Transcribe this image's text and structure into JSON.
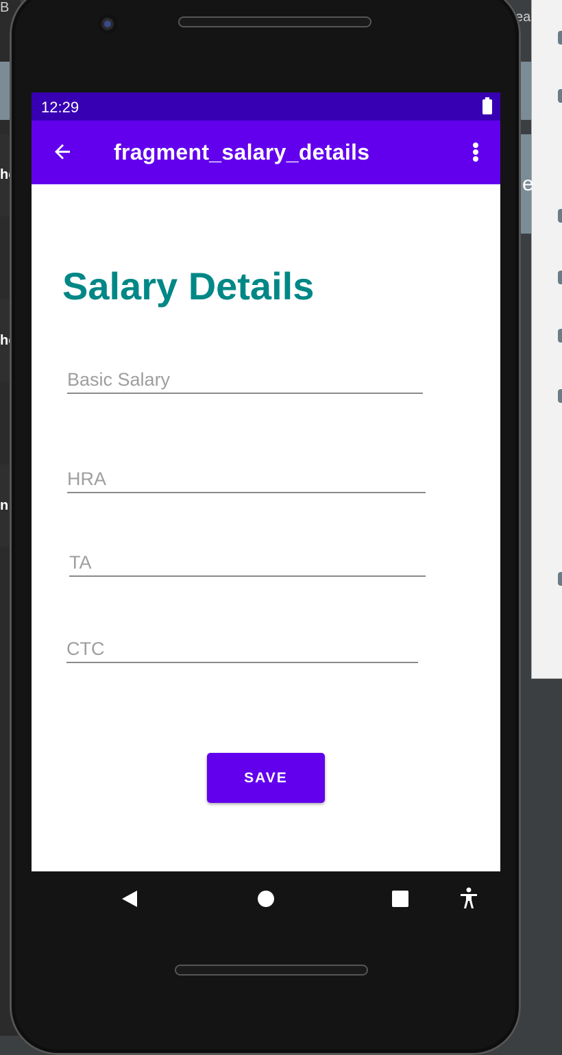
{
  "ide": {
    "top_left_text": "B",
    "top_right_text": "ea",
    "left_fragments": [
      "he",
      "he",
      "n"
    ],
    "right_fragment": "e"
  },
  "status_bar": {
    "time": "12:29"
  },
  "app_bar": {
    "title": "fragment_salary_details",
    "back_icon": "arrow-back-icon",
    "menu_icon": "more-vert-icon"
  },
  "form": {
    "heading": "Salary Details",
    "fields": [
      {
        "name": "basic-salary",
        "placeholder": "Basic Salary",
        "value": ""
      },
      {
        "name": "hra",
        "placeholder": "HRA",
        "value": ""
      },
      {
        "name": "ta",
        "placeholder": "TA",
        "value": ""
      },
      {
        "name": "ctc",
        "placeholder": "CTC",
        "value": ""
      }
    ],
    "save_label": "SAVE"
  },
  "colors": {
    "status_bar": "#3700b3",
    "app_bar": "#6200ee",
    "heading": "#018786",
    "button": "#6200ee"
  },
  "nav_bar": {
    "icons": [
      "back-triangle-icon",
      "home-circle-icon",
      "recents-square-icon",
      "accessibility-icon"
    ]
  }
}
